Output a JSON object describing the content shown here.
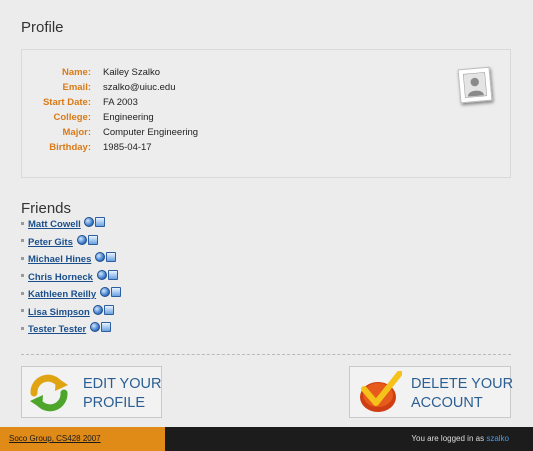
{
  "profile": {
    "heading": "Profile",
    "fields": [
      {
        "label": "Name:",
        "value": "Kailey Szalko"
      },
      {
        "label": "Email:",
        "value": "szalko@uiuc.edu"
      },
      {
        "label": "Start Date:",
        "value": "FA 2003"
      },
      {
        "label": "College:",
        "value": "Engineering"
      },
      {
        "label": "Major:",
        "value": "Computer Engineering"
      },
      {
        "label": "Birthday:",
        "value": "1985-04-17"
      }
    ],
    "avatar_icon": "user-silhouette-icon"
  },
  "friends": {
    "heading": "Friends",
    "items": [
      {
        "name": "Matt Cowell"
      },
      {
        "name": "Peter Gits"
      },
      {
        "name": "Michael Hines"
      },
      {
        "name": "Chris Horneck"
      },
      {
        "name": "Kathleen Reilly"
      },
      {
        "name": "Lisa Simpson"
      },
      {
        "name": "Tester Tester"
      }
    ],
    "icons": [
      "globe-icon",
      "document-icon"
    ]
  },
  "actions": {
    "edit": {
      "line1": "EDIT YOUR",
      "line2": "PROFILE",
      "icon": "refresh-arrows-icon"
    },
    "delete": {
      "line1": "DELETE YOUR",
      "line2": "ACCOUNT",
      "icon": "checkmark-icon"
    }
  },
  "footer": {
    "credit": "Soco Group, CS428 2007",
    "login_prefix": "You are logged in as",
    "username": "szalko"
  },
  "colors": {
    "label_orange": "#d97a17",
    "link_blue": "#1a4f8c",
    "button_text_blue": "#2b5e93",
    "footer_orange": "#e08a18",
    "footer_dark": "#1c1c1c",
    "username_blue": "#4a9be8"
  }
}
